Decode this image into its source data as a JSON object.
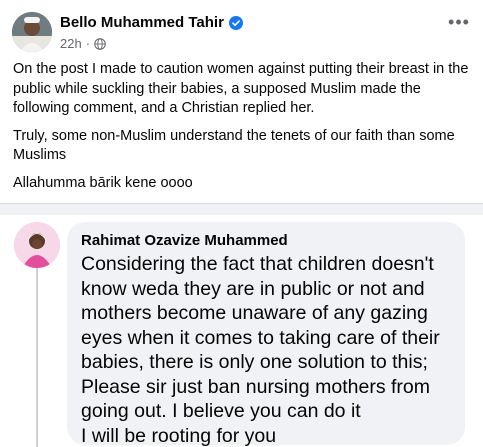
{
  "post": {
    "author": "Bello Muhammed Tahir",
    "time": "22h",
    "separator": "·",
    "more_label": "•••",
    "paragraphs": [
      "On the post I made to caution women against putting their breast in the public while suckling their babies, a supposed Muslim made the following comment, and a Christian replied her.",
      "Truly, some non-Muslim understand the tenets of our faith than some Muslims",
      "Allahumma bārik kene oooo"
    ]
  },
  "comment": {
    "author": "Rahimat Ozavize Muhammed",
    "text": "Considering the fact that children doesn't know weda they are in public or not and mothers become unaware of any gazing eyes when it comes to taking care of their babies, there is only one solution to this; Please sir just ban nursing mothers from going out. I believe you can do it\nI will be rooting for you"
  },
  "colors": {
    "verified": "#1877f2",
    "meta_gray": "#65676b",
    "bubble_bg": "#f0f2f5"
  },
  "icons": [
    "verified-badge-icon",
    "globe-icon",
    "more-options-icon"
  ]
}
